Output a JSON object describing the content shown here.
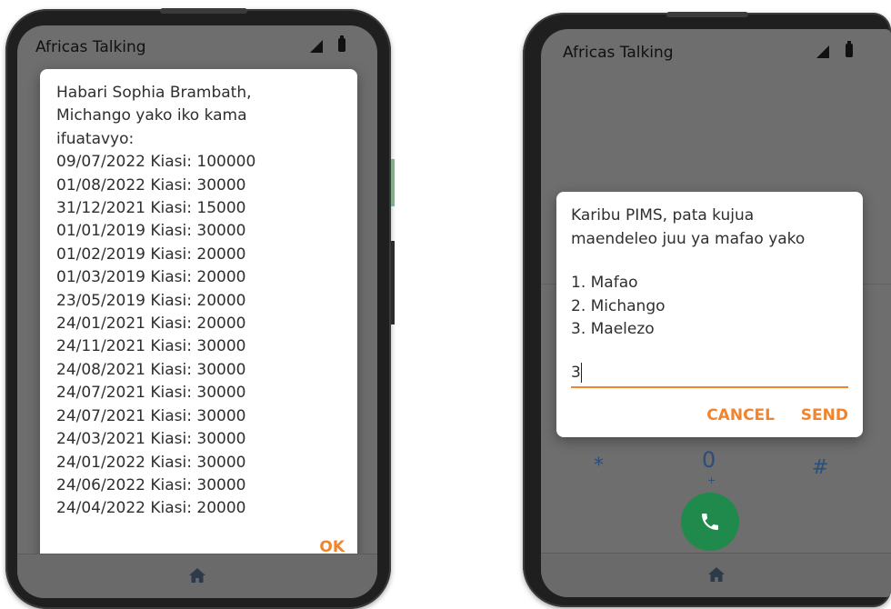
{
  "left_phone": {
    "app_title": "Africas Talking",
    "dialog": {
      "lines": [
        "Habari Sophia Brambath,",
        "Michango yako iko kama",
        "ifuatavyo:",
        "09/07/2022 Kiasi: 100000",
        "01/08/2022 Kiasi: 30000",
        "31/12/2021 Kiasi: 15000",
        "01/01/2019 Kiasi: 30000",
        "01/02/2019 Kiasi: 20000",
        "01/03/2019 Kiasi: 20000",
        "23/05/2019 Kiasi: 20000",
        "24/01/2021 Kiasi: 20000",
        "24/11/2021 Kiasi: 30000",
        "24/08/2021 Kiasi: 30000",
        "24/07/2021 Kiasi: 30000",
        "24/07/2021 Kiasi: 30000",
        "24/03/2021 Kiasi: 30000",
        "24/01/2022 Kiasi: 30000",
        "24/06/2022 Kiasi: 30000",
        "24/04/2022 Kiasi: 20000"
      ],
      "ok_label": "OK"
    }
  },
  "right_phone": {
    "app_title": "Africas Talking",
    "dialog": {
      "line1": "Karibu PIMS, pata kujua",
      "line2": "maendeleo juu ya mafao yako",
      "options": [
        "1. Mafao",
        "2. Michango",
        "3. Maelezo"
      ],
      "input_value": "3",
      "cancel_label": "CANCEL",
      "send_label": "SEND"
    },
    "keypad": {
      "star": "*",
      "zero": "0",
      "plus": "+",
      "hash": "#"
    }
  },
  "colors": {
    "accent": "#f0852d",
    "call": "#1f8a4c",
    "scrim": "#6e6e6e"
  },
  "icons": [
    "signal-icon",
    "battery-icon",
    "home-icon",
    "phone-icon"
  ]
}
